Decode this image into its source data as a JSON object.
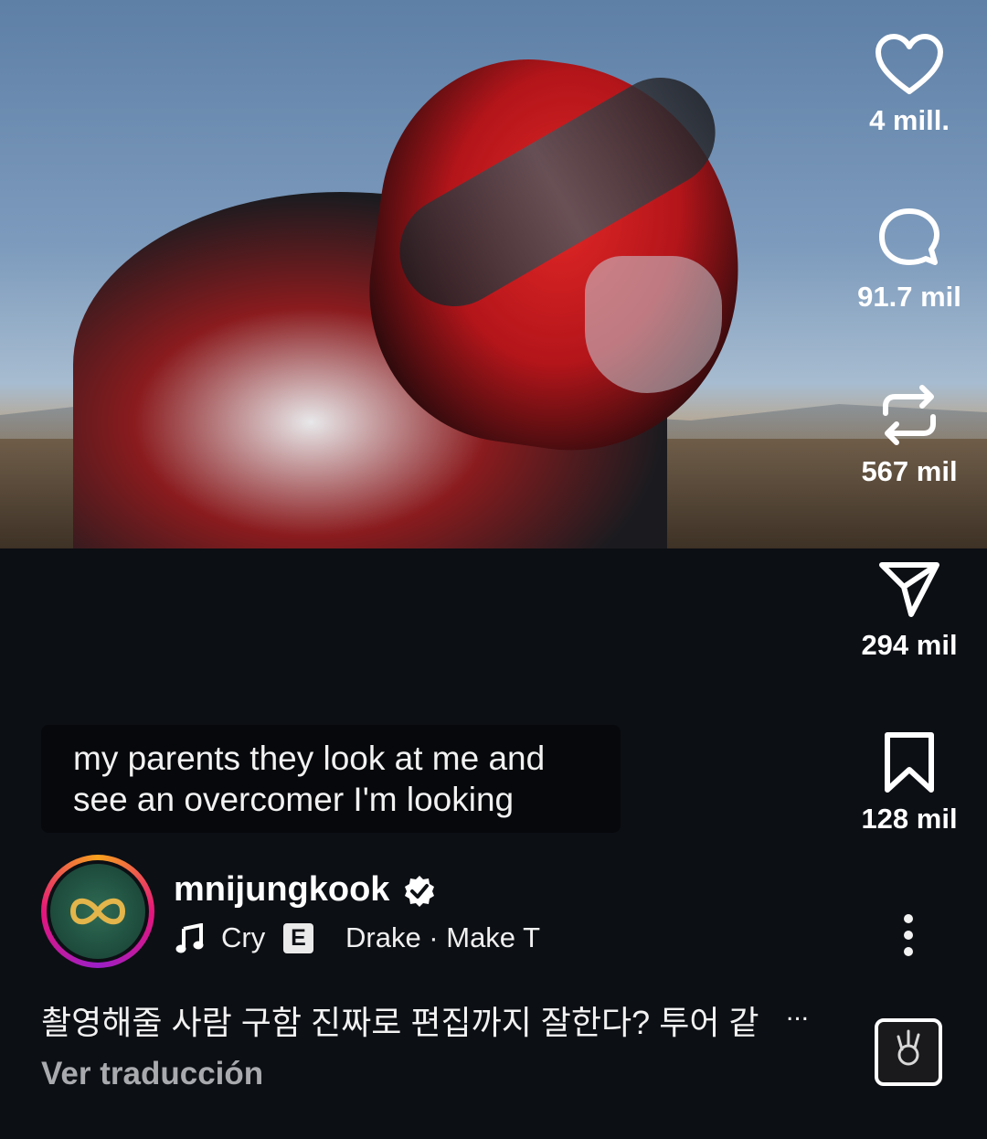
{
  "video": {
    "description_icon": "video-frame"
  },
  "actions": {
    "like": {
      "icon": "heart-icon",
      "count": "4 mill."
    },
    "comment": {
      "icon": "comment-bubble-icon",
      "count": "91.7 mil"
    },
    "repost": {
      "icon": "repost-icon",
      "count": "567 mil"
    },
    "share": {
      "icon": "send-icon",
      "count": "294 mil"
    },
    "save": {
      "icon": "bookmark-icon",
      "count": "128 mil"
    }
  },
  "subtitle": {
    "line1": "my parents they look at me and",
    "line2": "see an overcomer I'm looking"
  },
  "author": {
    "username": "mnijungkook",
    "verified_icon": "verified-badge-icon"
  },
  "music": {
    "note_icon": "music-note-icon",
    "song": "Cry",
    "explicit": "E",
    "artist": "Drake · Make T"
  },
  "caption": {
    "text": "촬영해줄 사람 구함 진짜로 편집까지 잘한다? 투어 같",
    "more": "..."
  },
  "translate": {
    "label": "Ver traducción"
  },
  "colors": {
    "background": "#0c0f14",
    "muted": "#a8aaae"
  }
}
